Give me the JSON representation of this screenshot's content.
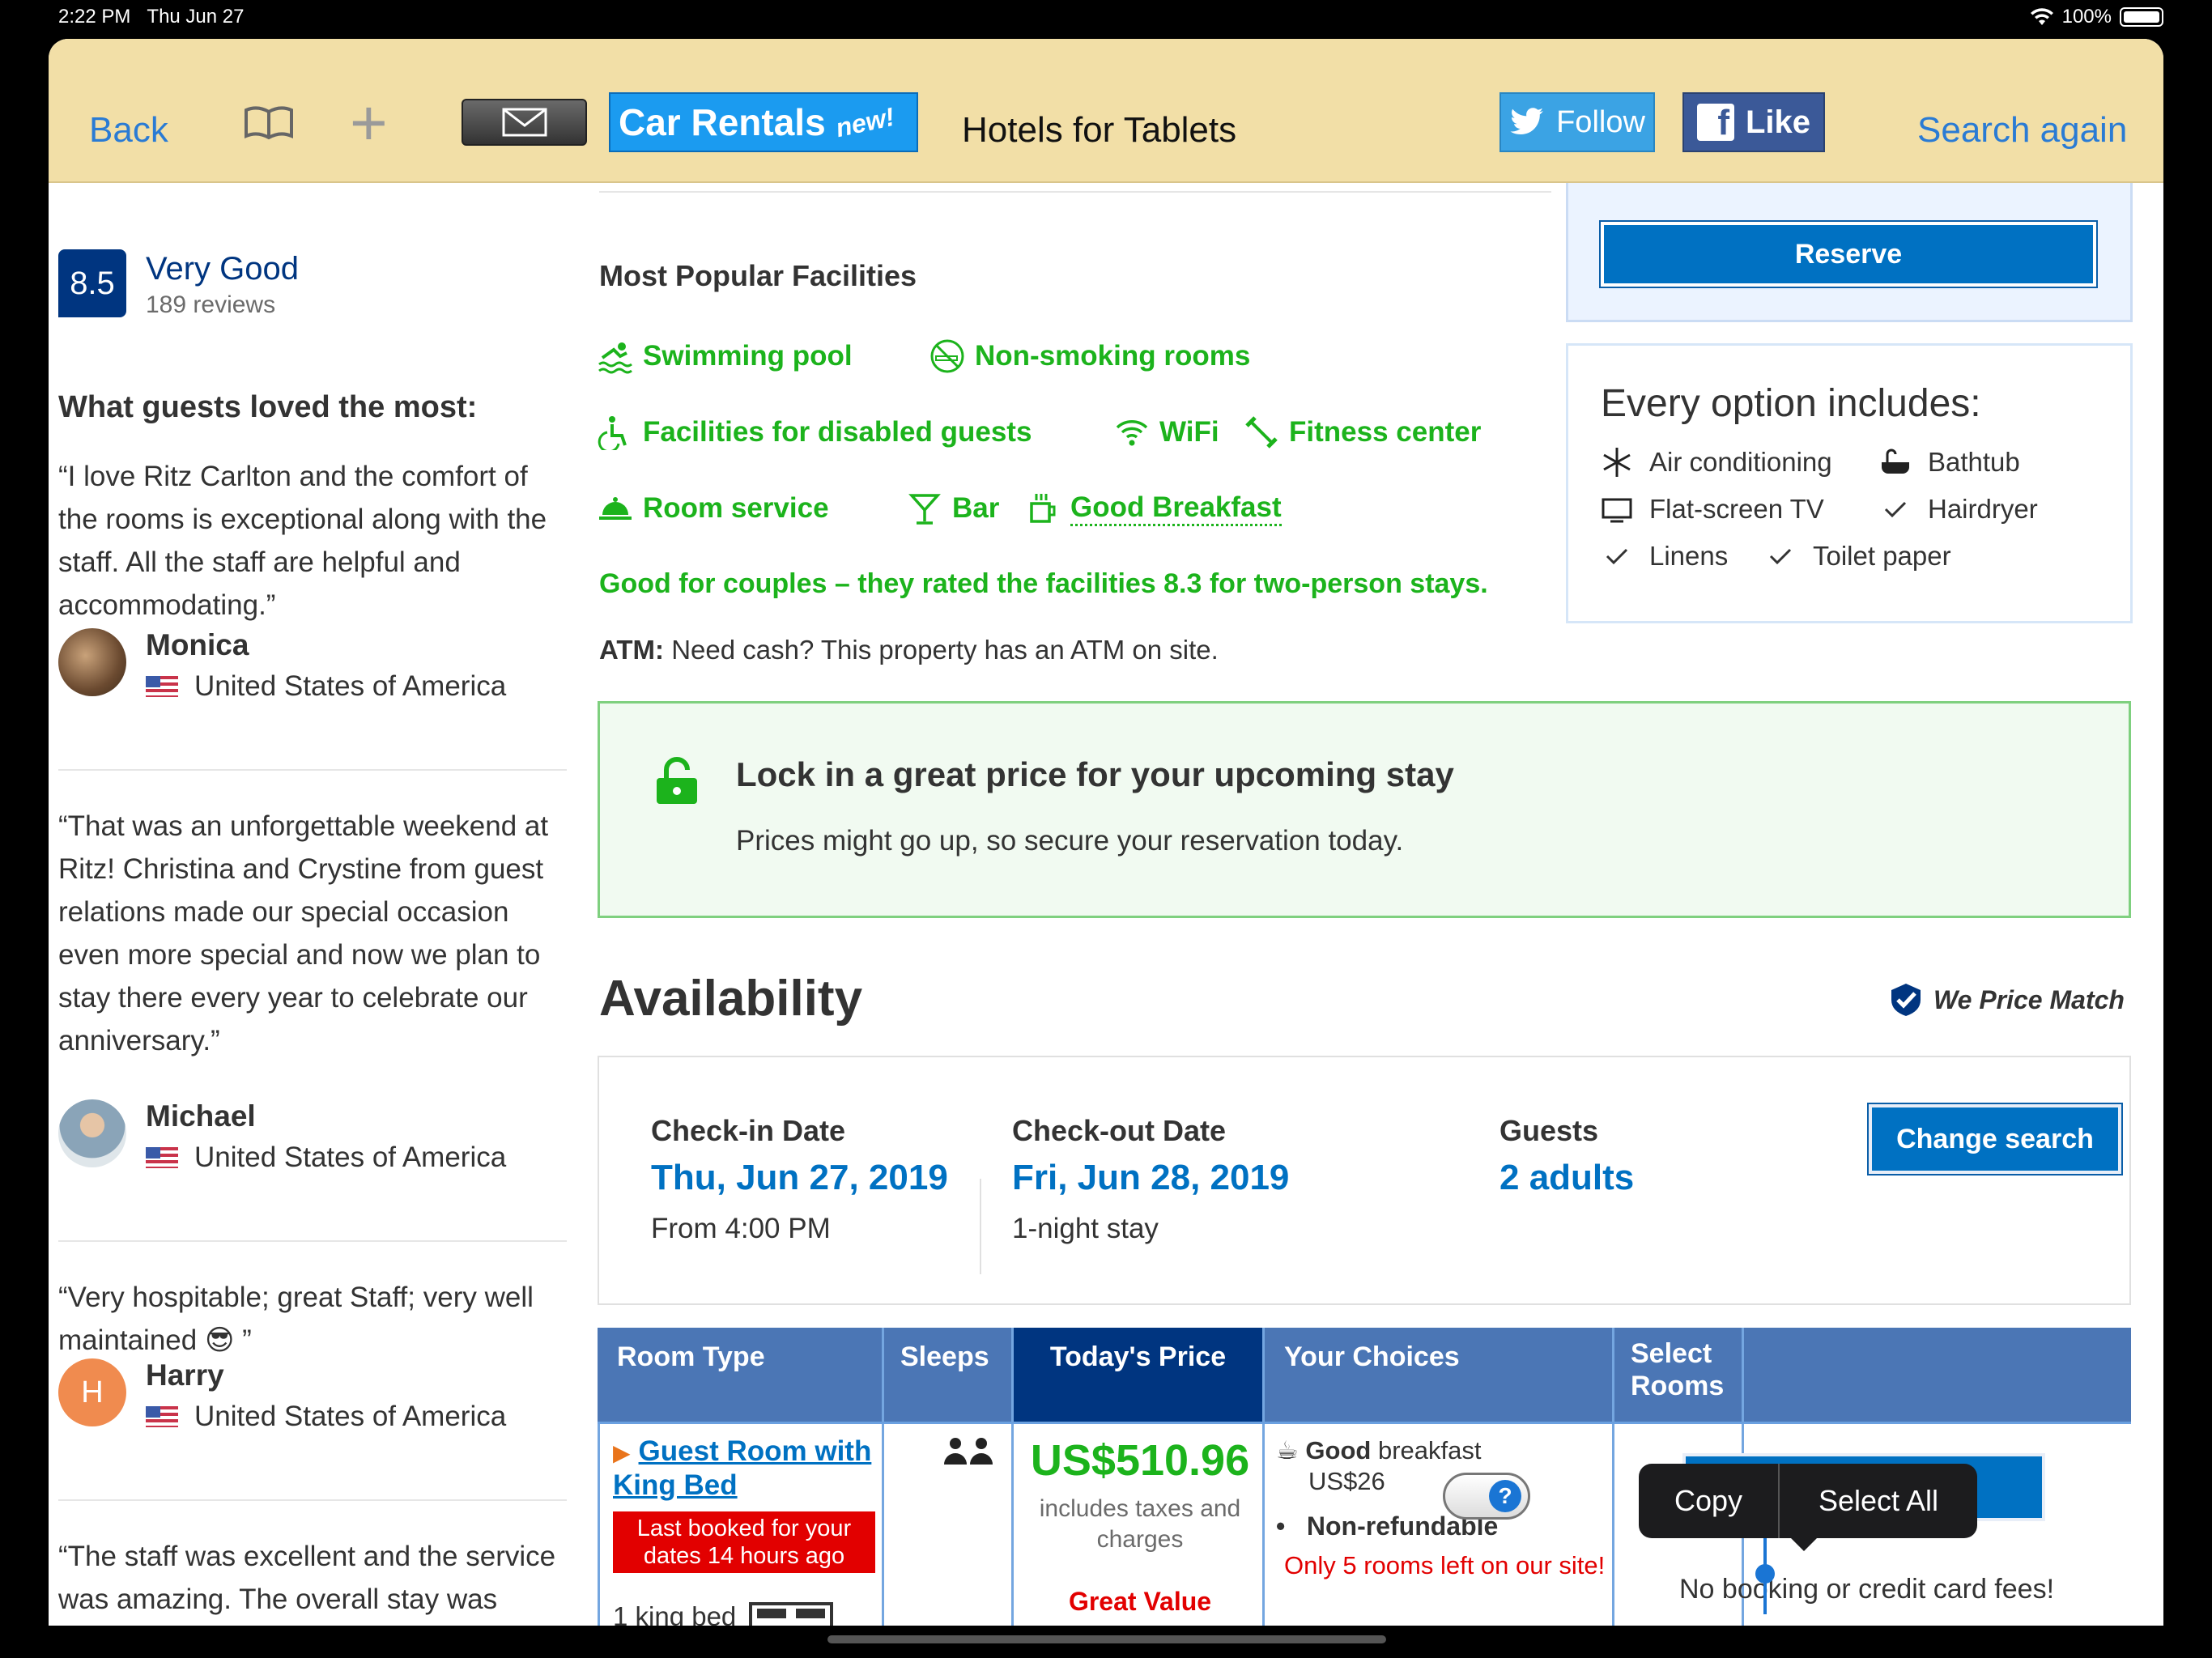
{
  "status": {
    "time": "2:22 PM",
    "date": "Thu Jun 27",
    "battery": "100%"
  },
  "toolbar": {
    "back": "Back",
    "car_rentals": "Car Rentals",
    "car_new": "new!",
    "title": "Hotels for Tablets",
    "follow": "Follow",
    "like": "Like",
    "search_again": "Search again"
  },
  "rating": {
    "score": "8.5",
    "label": "Very Good",
    "count": "189 reviews"
  },
  "loved_heading": "What guests loved the most:",
  "reviews": [
    {
      "text": "“I love Ritz Carlton and the comfort of the rooms is exceptional along with the staff. All the staff are helpful and accommodating.”",
      "name": "Monica",
      "country": "United States of America"
    },
    {
      "text": "“That was an unforgettable weekend at Ritz! Christina and Crystine from guest relations made our special occasion even more special and now we plan to stay there every year to celebrate our anniversary.”",
      "name": "Michael",
      "country": "United States of America"
    },
    {
      "text": "“Very hospitable; great Staff; very well maintained 😎 ”",
      "name": "Harry",
      "initial": "H",
      "country": "United States of America"
    },
    {
      "text": "“The staff was excellent and the service was amazing. The overall stay was great.”"
    }
  ],
  "facilities": {
    "heading": "Most Popular Facilities",
    "items": [
      "Swimming pool",
      "Non-smoking rooms",
      "Facilities for disabled guests",
      "WiFi",
      "Fitness center",
      "Room service",
      "Bar",
      "Good Breakfast"
    ],
    "couples": "Good for couples – they rated the facilities 8.3 for two-person stays.",
    "atm_label": "ATM:",
    "atm_text": "Need cash? This property has an ATM on site."
  },
  "lock": {
    "title": "Lock in a great price for your upcoming stay",
    "subtitle": "Prices might go up, so secure your reservation today."
  },
  "availability": {
    "heading": "Availability",
    "price_match": "We Price Match",
    "checkin_label": "Check-in Date",
    "checkin_value": "Thu, Jun 27, 2019",
    "checkin_sub": "From 4:00 PM",
    "checkout_label": "Check-out Date",
    "checkout_value": "Fri, Jun 28, 2019",
    "checkout_sub": "1-night stay",
    "guests_label": "Guests",
    "guests_value": "2 adults",
    "change": "Change search"
  },
  "table": {
    "headers": [
      "Room Type",
      "Sleeps",
      "Today's Price",
      "Your Choices",
      "Select Rooms"
    ],
    "room_name": "Guest Room with King Bed",
    "last_booked": "Last booked for your dates 14 hours ago",
    "bed": "1 king bed",
    "price": "US$510.96",
    "price_note": "includes taxes and charges",
    "great_value": "Great Value",
    "breakfast_bold": "Good",
    "breakfast_rest": "breakfast",
    "breakfast_price": "US$26",
    "nonrefundable": "Non-refundable",
    "rooms_left": "Only 5 rooms left on our site!",
    "reserve": "Reserve",
    "no_fees": "No booking or credit card fees!"
  },
  "context_menu": {
    "copy": "Copy",
    "select_all": "Select All"
  },
  "sidebar_reserve": "Reserve",
  "includes": {
    "heading": "Every option includes:",
    "items": [
      "Air conditioning",
      "Bathtub",
      "Flat-screen TV",
      "Hairdryer",
      "Linens",
      "Toilet paper"
    ]
  },
  "colors": {
    "brand_blue": "#003580",
    "link_blue": "#0071c2",
    "green": "#1cb31c",
    "red": "#e20000",
    "toolbar": "#f2dfa7"
  }
}
